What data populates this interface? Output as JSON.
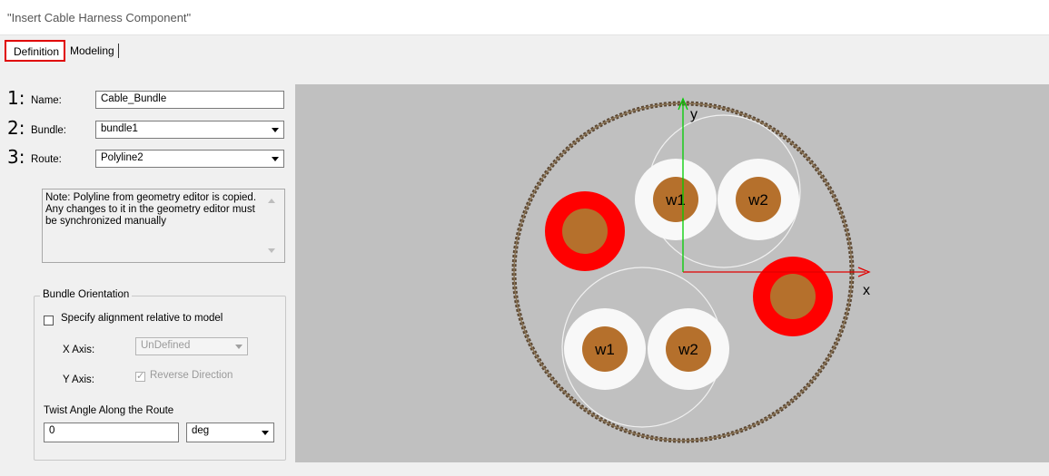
{
  "window": {
    "title": "\"Insert Cable Harness Component\""
  },
  "tabs": [
    {
      "label": "Definition",
      "active": true
    },
    {
      "label": "Modeling",
      "active": false
    }
  ],
  "form": {
    "name": {
      "number": "1:",
      "label": "Name:",
      "value": "Cable_Bundle"
    },
    "bundle": {
      "number": "2:",
      "label": "Bundle:",
      "value": "bundle1"
    },
    "route": {
      "number": "3:",
      "label": "Route:",
      "value": "Polyline2"
    },
    "note": "Note: Polyline from geometry editor is copied. Any changes to it in the geometry editor must be synchronized manually"
  },
  "orientation": {
    "title": "Bundle Orientation",
    "specify_label": "Specify alignment relative to model",
    "specify_checked": false,
    "x_axis_label": "X Axis:",
    "x_axis_value": "UnDefined",
    "y_axis_label": "Y Axis:",
    "reverse_label": "Reverse Direction",
    "reverse_checked": true,
    "twist_label": "Twist Angle Along the Route",
    "twist_value": "0",
    "twist_unit": "deg"
  },
  "diagram": {
    "x_label": "x",
    "y_label": "y",
    "wire_labels": [
      "w1",
      "w2",
      "w1",
      "w2"
    ],
    "colors": {
      "background": "#c0c0c0",
      "axis_x": "#e00000",
      "axis_y": "#00cc00",
      "copper": "#b5702c",
      "insulation_red": "#ff0000",
      "insulation_white": "#f8f8f8",
      "sheath": "#5a4632"
    }
  }
}
